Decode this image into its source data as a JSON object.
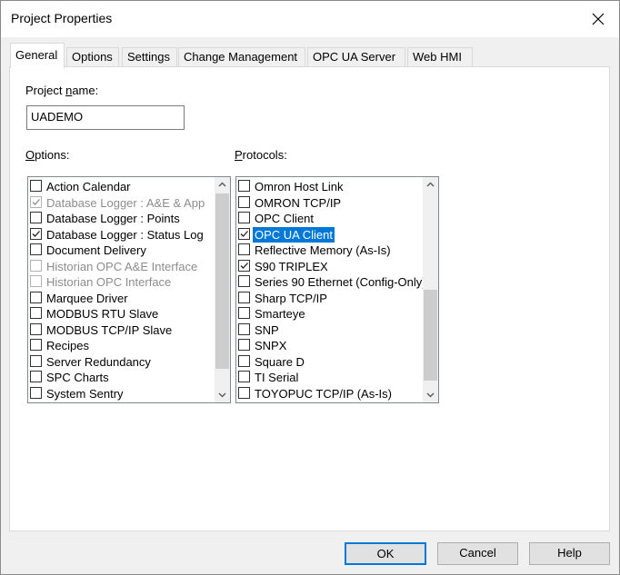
{
  "window": {
    "title": "Project Properties"
  },
  "tabs": [
    {
      "label": "General",
      "active": true
    },
    {
      "label": "Options"
    },
    {
      "label": "Settings"
    },
    {
      "label": "Change Management"
    },
    {
      "label": "OPC UA Server"
    },
    {
      "label": "Web HMI"
    }
  ],
  "general": {
    "project_name_label_prefix": "Project ",
    "project_name_label_underlined": "n",
    "project_name_label_suffix": "ame:",
    "project_name_value": "UADEMO",
    "options_label_prefix": "",
    "options_label_underlined": "O",
    "options_label_suffix": "ptions:",
    "protocols_label_prefix": "",
    "protocols_label_underlined": "P",
    "protocols_label_suffix": "rotocols:"
  },
  "options_list": [
    {
      "label": "Action Calendar",
      "checked": false,
      "disabled": false
    },
    {
      "label": "Database Logger : A&E & App",
      "checked": true,
      "disabled": true
    },
    {
      "label": "Database Logger : Points",
      "checked": false,
      "disabled": false
    },
    {
      "label": "Database Logger : Status Log",
      "checked": true,
      "disabled": false
    },
    {
      "label": "Document Delivery",
      "checked": false,
      "disabled": false
    },
    {
      "label": "Historian OPC A&E Interface",
      "checked": false,
      "disabled": true
    },
    {
      "label": "Historian OPC Interface",
      "checked": false,
      "disabled": true
    },
    {
      "label": "Marquee Driver",
      "checked": false,
      "disabled": false
    },
    {
      "label": "MODBUS RTU Slave",
      "checked": false,
      "disabled": false
    },
    {
      "label": "MODBUS TCP/IP Slave",
      "checked": false,
      "disabled": false
    },
    {
      "label": "Recipes",
      "checked": false,
      "disabled": false
    },
    {
      "label": "Server Redundancy",
      "checked": false,
      "disabled": false
    },
    {
      "label": "SPC Charts",
      "checked": false,
      "disabled": false
    },
    {
      "label": "System Sentry",
      "checked": false,
      "disabled": false
    }
  ],
  "protocols_list": [
    {
      "label": "Omron Host Link",
      "checked": false
    },
    {
      "label": "OMRON TCP/IP",
      "checked": false
    },
    {
      "label": "OPC Client",
      "checked": false
    },
    {
      "label": "OPC UA Client",
      "checked": true,
      "selected": true
    },
    {
      "label": "Reflective Memory (As-Is)",
      "checked": false
    },
    {
      "label": "S90 TRIPLEX",
      "checked": true
    },
    {
      "label": "Series 90 Ethernet (Config-Only)",
      "checked": false
    },
    {
      "label": "Sharp TCP/IP",
      "checked": false
    },
    {
      "label": "Smarteye",
      "checked": false
    },
    {
      "label": "SNP",
      "checked": false
    },
    {
      "label": "SNPX",
      "checked": false
    },
    {
      "label": "Square D",
      "checked": false
    },
    {
      "label": "TI Serial",
      "checked": false
    },
    {
      "label": "TOYOPUC TCP/IP (As-Is)",
      "checked": false
    }
  ],
  "buttons": {
    "ok": "OK",
    "cancel": "Cancel",
    "help": "Help"
  },
  "colors": {
    "selection": "#0078d7",
    "default_button_border": "#0078d7"
  }
}
